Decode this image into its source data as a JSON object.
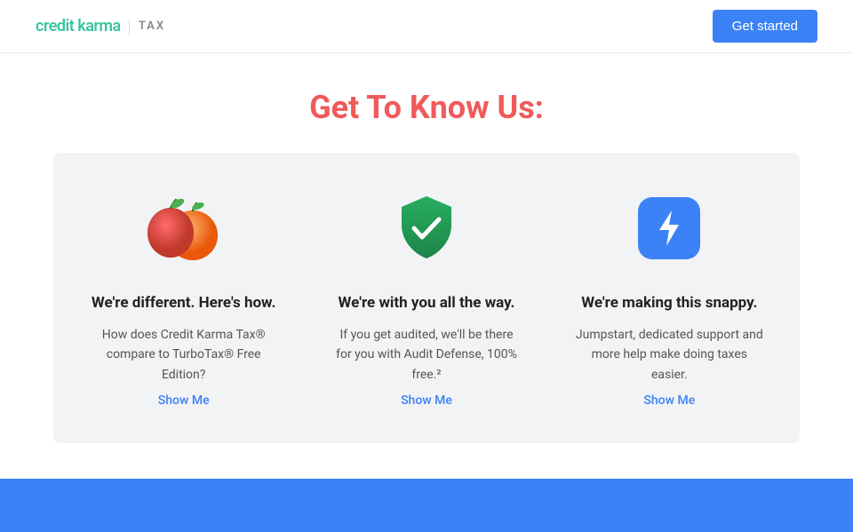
{
  "header": {
    "logo_credit_karma": "credit karma",
    "logo_separator": "|",
    "logo_tax": "TAX",
    "cta_button_label": "Get started"
  },
  "main": {
    "page_title": "Get To Know Us:",
    "cards": [
      {
        "icon": "apple-orange",
        "title": "We're different. Here's how.",
        "description": "How does Credit Karma Tax® compare to TurboTax® Free Edition?",
        "link_text": "Show Me"
      },
      {
        "icon": "shield-check",
        "title": "We're with you all the way.",
        "description": "If you get audited, we'll be there for you with Audit Defense, 100% free.²",
        "link_text": "Show Me"
      },
      {
        "icon": "lightning",
        "title": "We're making this snappy.",
        "description": "Jumpstart, dedicated support and more help make doing taxes easier.",
        "link_text": "Show Me"
      }
    ]
  }
}
